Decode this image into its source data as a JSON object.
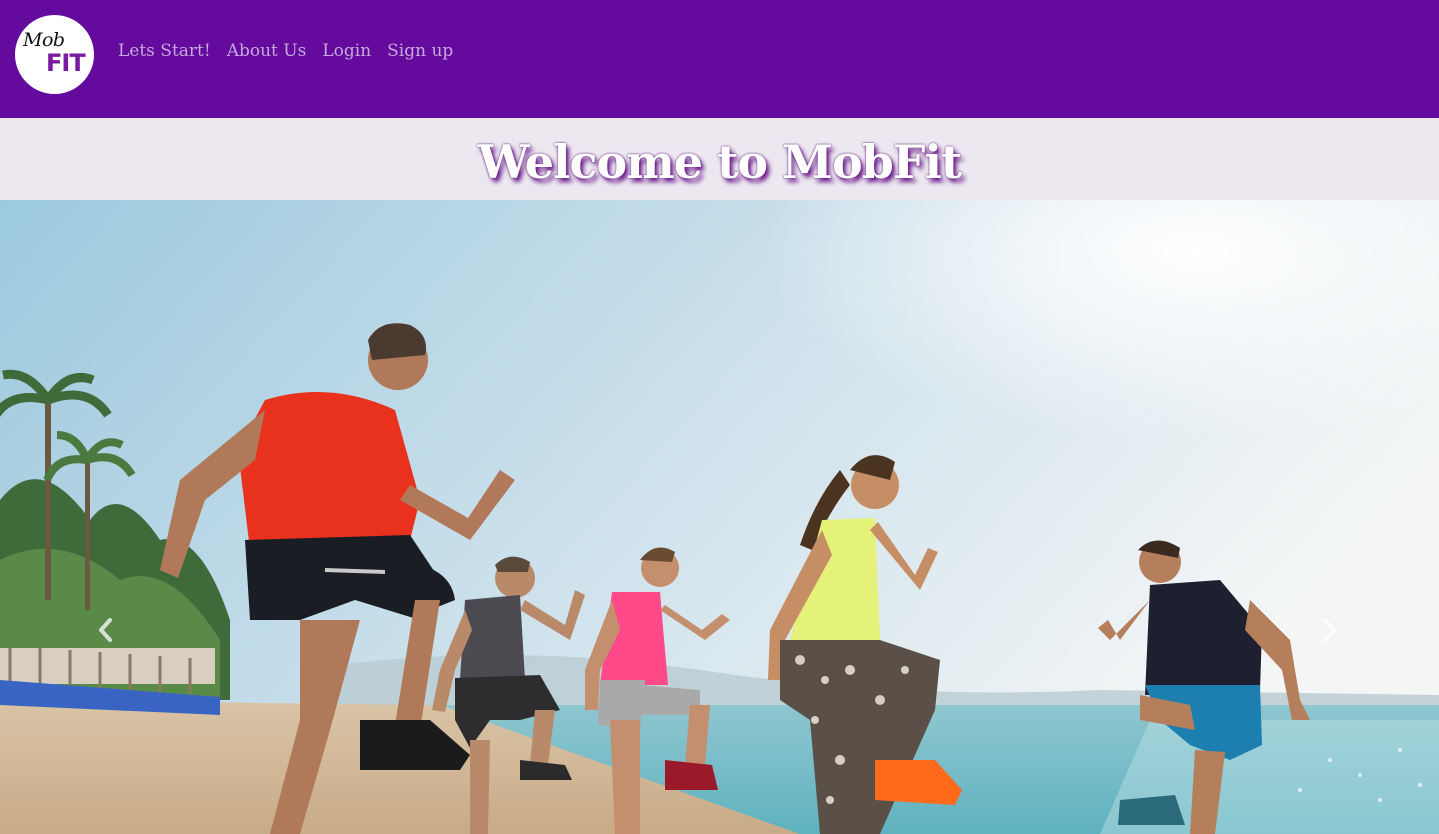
{
  "brand": {
    "logo_word_top": "Mob",
    "logo_word_bottom": "FIT"
  },
  "nav": {
    "items": [
      {
        "label": "Lets Start!"
      },
      {
        "label": "About Us"
      },
      {
        "label": "Login"
      },
      {
        "label": "Sign up"
      }
    ]
  },
  "hero": {
    "title": "Welcome to MobFit"
  },
  "carousel": {
    "prev_icon": "chevron-left-icon",
    "next_icon": "chevron-right-icon",
    "image_description_icon": "beach-workout-photo"
  },
  "colors": {
    "navbar": "#640a9c",
    "nav_link": "#c7a8dc",
    "band": "#ede8f0",
    "title_shadow": "#6a1a8a"
  }
}
